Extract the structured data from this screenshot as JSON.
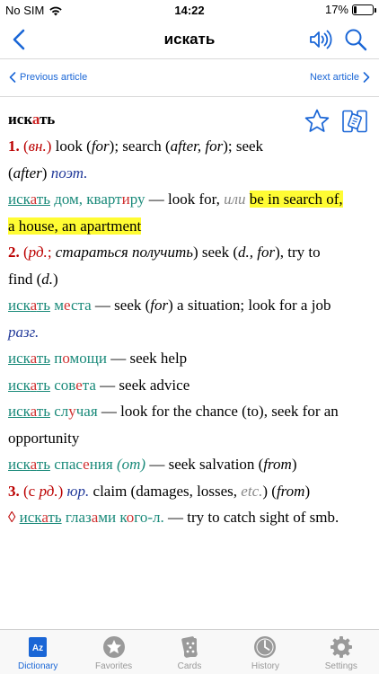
{
  "status": {
    "carrier": "No SIM",
    "time": "14:22",
    "battery": "17%",
    "battery_fraction": 0.17
  },
  "navbar": {
    "title": "искать"
  },
  "article_nav": {
    "previous": "Previous article",
    "next": "Next article"
  },
  "article": {
    "headword": {
      "pre": "иск",
      "stress": "а",
      "post": "ть"
    },
    "s1": {
      "num": "1.",
      "gram_open": "(",
      "gram": "вн.",
      "gram_close": ")",
      "t1": " look (",
      "t1i": "for",
      "t2": "); search (",
      "t2i": "after, for",
      "t3": "); seek",
      "t4": "(",
      "t4i": "after",
      "t5": ") ",
      "label": "поэт."
    },
    "ex1": {
      "ru_pre": "иск",
      "ru_s": "а",
      "ru_post": "ть",
      "ru_rest_a": " дом, кварт",
      "ru_rest_s": "и",
      "ru_rest_b": "ру",
      "dash": " — look for, ",
      "or": "или",
      "hl1": "be in search of,",
      "hl2": "a house, an apartment"
    },
    "s2": {
      "num": "2.",
      "open": " (",
      "gram": "рд.",
      "sep": "; ",
      "gram2": "стараться получить",
      "t1": ") seek (",
      "t1i": "d., for",
      "t2": "), try to",
      "t3": "find (",
      "t3i": "d.",
      "t4": ")"
    },
    "ex2": {
      "ru_pre": "иск",
      "ru_s": "а",
      "ru_post": "ть",
      "rest_a": " м",
      "rest_s": "е",
      "rest_b": "ста",
      "t1": " — seek (",
      "t1i": "for",
      "t2": ") a situation; look for a job",
      "label": "разг."
    },
    "ex3": {
      "ru_pre": "иск",
      "ru_s": "а",
      "ru_post": "ть",
      "rest_a": " п",
      "rest_s": "о",
      "rest_b": "мощи",
      "t": " — seek help"
    },
    "ex4": {
      "ru_pre": "иск",
      "ru_s": "а",
      "ru_post": "ть",
      "rest_a": " сов",
      "rest_s": "е",
      "rest_b": "та",
      "t": " — seek advice"
    },
    "ex5": {
      "ru_pre": "иск",
      "ru_s": "а",
      "ru_post": "ть",
      "rest_a": " сл",
      "rest_s": "у",
      "rest_b": "чая",
      "t1": " — look for the chance (to), seek for an",
      "t2": "opportunity"
    },
    "ex6": {
      "ru_pre": "иск",
      "ru_s": "а",
      "ru_post": "ть",
      "rest_a": " спас",
      "rest_s": "е",
      "rest_b": "ния",
      "paren": " (от)",
      "t1": " — seek salvation (",
      "t1i": "from",
      "t2": ")"
    },
    "s3": {
      "num": "3.",
      "open": " (с ",
      "gram": "рд.",
      "close": ") ",
      "label": "юр.",
      "t1": " claim (damages, losses, ",
      "etc": "etc.",
      "t2": ") (",
      "t2i": "from",
      "t3": ")"
    },
    "ex7": {
      "marker": "◊ ",
      "ru_pre": "иск",
      "ru_s": "а",
      "ru_post": "ть",
      "rest_a": " глаз",
      "rest_s": "а",
      "rest_b": "ми к",
      "rest_s2": "о",
      "rest_c": "го-л.",
      "t": " — try to catch sight of smb."
    }
  },
  "tabs": [
    {
      "label": "Dictionary",
      "icon": "dictionary-icon",
      "active": true
    },
    {
      "label": "Favorites",
      "icon": "star-icon",
      "active": false
    },
    {
      "label": "Cards",
      "icon": "cards-icon",
      "active": false
    },
    {
      "label": "History",
      "icon": "clock-icon",
      "active": false
    },
    {
      "label": "Settings",
      "icon": "gear-icon",
      "active": false
    }
  ],
  "colors": {
    "accent": "#1a66d6",
    "russian": "#1a8a7a",
    "stress": "#d03030",
    "highlight": "#fffc33",
    "sense_number": "#bb0000"
  }
}
